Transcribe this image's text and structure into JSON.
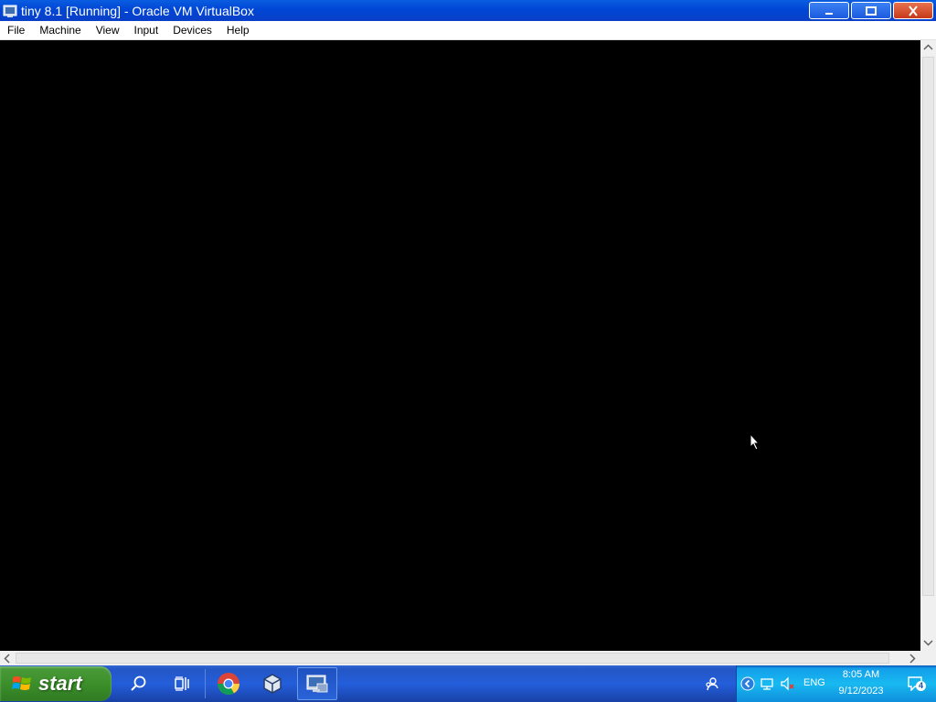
{
  "window": {
    "title": "tiny 8.1 [Running] - Oracle VM VirtualBox",
    "icon": "virtualbox-vm-icon"
  },
  "menu": [
    "File",
    "Machine",
    "View",
    "Input",
    "Devices",
    "Help"
  ],
  "taskbar": {
    "start_label": "start",
    "pinned": [
      "search-icon",
      "task-view-icon",
      "chrome-icon",
      "virtualbox-icon",
      "vm-window-icon"
    ],
    "tray": {
      "language": "ENG",
      "time": "8:05 AM",
      "date": "9/12/2023",
      "notification_count": "4"
    }
  },
  "colors": {
    "titlebar": "#0046d5",
    "taskbar": "#245edb",
    "start": "#3c8f2b",
    "tray": "#18b9f1"
  }
}
